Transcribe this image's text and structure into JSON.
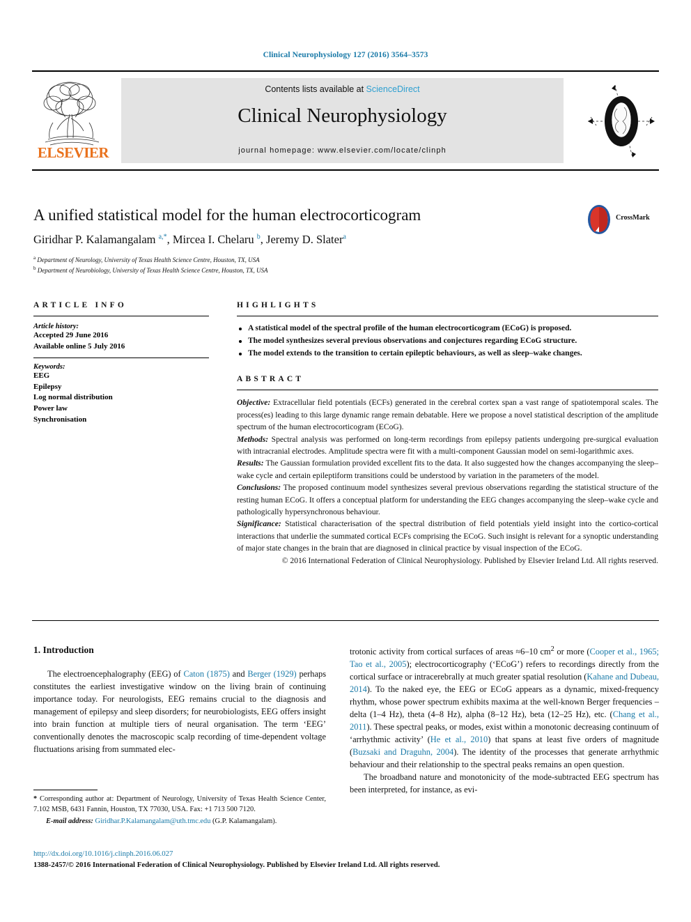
{
  "running_head": "Clinical Neurophysiology 127 (2016) 3564–3573",
  "masthead": {
    "contents_prefix": "Contents lists available at ",
    "sciencedirect": "ScienceDirect",
    "journal_name": "Clinical Neurophysiology",
    "homepage": "journal homepage: www.elsevier.com/locate/clinph",
    "publisher": "ELSEVIER",
    "publisher_color": "#e9711c",
    "link_color": "#2d9fd0"
  },
  "article": {
    "title": "A unified statistical model for the human electrocorticogram",
    "authors_html": "Giridhar P. Kalamangalam <sup>a,*</sup>, Mircea I. Chelaru <sup>b</sup>, Jeremy D. Slater<sup>a</sup>",
    "affiliations": [
      "Department of Neurology, University of Texas Health Science Centre, Houston, TX, USA",
      "Department of Neurobiology, University of Texas Health Science Centre, Houston, TX, USA"
    ],
    "crossmark_label": "CrossMark"
  },
  "article_info": {
    "heading": "ARTICLE INFO",
    "history_label": "Article history:",
    "history": [
      "Accepted 29 June 2016",
      "Available online 5 July 2016"
    ],
    "keywords_label": "Keywords:",
    "keywords": [
      "EEG",
      "Epilepsy",
      "Log normal distribution",
      "Power law",
      "Synchronisation"
    ]
  },
  "highlights": {
    "heading": "HIGHLIGHTS",
    "items": [
      "A statistical model of the spectral profile of the human electrocorticogram (ECoG) is proposed.",
      "The model synthesizes several previous observations and conjectures regarding ECoG structure.",
      "The model extends to the transition to certain epileptic behaviours, as well as sleep–wake changes."
    ]
  },
  "abstract": {
    "heading": "ABSTRACT",
    "sections": [
      {
        "label": "Objective:",
        "text": "Extracellular field potentials (ECFs) generated in the cerebral cortex span a vast range of spatiotemporal scales. The process(es) leading to this large dynamic range remain debatable. Here we propose a novel statistical description of the amplitude spectrum of the human electrocorticogram (ECoG)."
      },
      {
        "label": "Methods:",
        "text": "Spectral analysis was performed on long-term recordings from epilepsy patients undergoing pre-surgical evaluation with intracranial electrodes. Amplitude spectra were fit with a multi-component Gaussian model on semi-logarithmic axes."
      },
      {
        "label": "Results:",
        "text": "The Gaussian formulation provided excellent fits to the data. It also suggested how the changes accompanying the sleep–wake cycle and certain epileptiform transitions could be understood by variation in the parameters of the model."
      },
      {
        "label": "Conclusions:",
        "text": "The proposed continuum model synthesizes several previous observations regarding the statistical structure of the resting human ECoG. It offers a conceptual platform for understanding the EEG changes accompanying the sleep–wake cycle and pathologically hypersynchronous behaviour."
      },
      {
        "label": "Significance:",
        "text": "Statistical characterisation of the spectral distribution of field potentials yield insight into the cortico-cortical interactions that underlie the summated cortical ECFs comprising the ECoG. Such insight is relevant for a synoptic understanding of major state changes in the brain that are diagnosed in clinical practice by visual inspection of the ECoG."
      }
    ],
    "copyright": "© 2016 International Federation of Clinical Neurophysiology. Published by Elsevier Ireland Ltd. All rights reserved."
  },
  "introduction": {
    "heading": "1. Introduction",
    "left_paragraph_html": "The electroencephalography (EEG) of <span class=\"cite\">Caton (1875)</span> and <span class=\"cite\">Berger (1929)</span> perhaps constitutes the earliest investigative window on the living brain of continuing importance today. For neurologists, EEG remains crucial to the diagnosis and management of epilepsy and sleep disorders; for neurobiologists, EEG offers insight into brain function at multiple tiers of neural organisation. The term &lsquo;EEG&rsquo; conventionally denotes the macroscopic scalp recording of time-dependent voltage fluctuations arising from summated elec-",
    "right_paragraph_1_html": "trotonic activity from cortical surfaces of areas &asymp;6&ndash;10 cm<sup>2</sup> or more (<span class=\"cite\">Cooper et al., 1965; Tao et al., 2005</span>); electrocorticography (&lsquo;ECoG&rsquo;) refers to recordings directly from the cortical surface or intracerebrally at much greater spatial resolution (<span class=\"cite\">Kahane and Dubeau, 2014</span>). To the naked eye, the EEG or ECoG appears as a dynamic, mixed-frequency rhythm, whose power spectrum exhibits maxima at the well-known Berger frequencies &ndash; delta (1&ndash;4 Hz), theta (4&ndash;8 Hz), alpha (8&ndash;12 Hz), beta (12&ndash;25 Hz), etc. (<span class=\"cite\">Chang et al., 2011</span>). These spectral peaks, or modes, exist within a monotonic decreasing continuum of &lsquo;arrhythmic activity&rsquo; (<span class=\"cite\">He et al., 2010</span>) that spans at least five orders of magnitude (<span class=\"cite\">Buzsaki and Draguhn, 2004</span>). The identity of the processes that generate arrhythmic behaviour and their relationship to the spectral peaks remains an open question.",
    "right_paragraph_2_html": "The broadband nature and monotonicity of the mode-subtracted EEG spectrum has been interpreted, for instance, as evi-"
  },
  "footnotes": {
    "corresponding_html": "<b>*</b> Corresponding author at: Department of Neurology, University of Texas Health Science Center, 7.102 MSB, 6431 Fannin, Houston, TX 77030, USA. Fax: +1 713 500 7120.",
    "email_label": "E-mail address:",
    "email": "Giridhar.P.Kalamangalam@uth.tmc.edu",
    "email_owner": "(G.P. Kalamangalam)."
  },
  "bottom": {
    "doi": "http://dx.doi.org/10.1016/j.clinph.2016.06.027",
    "issn_line": "1388-2457/© 2016 International Federation of Clinical Neurophysiology. Published by Elsevier Ireland Ltd. All rights reserved."
  },
  "colors": {
    "link": "#1a7aa8",
    "sciencedirect": "#2d9fd0",
    "elsevier_orange": "#e9711c",
    "panel_grey": "#e3e3e3"
  }
}
